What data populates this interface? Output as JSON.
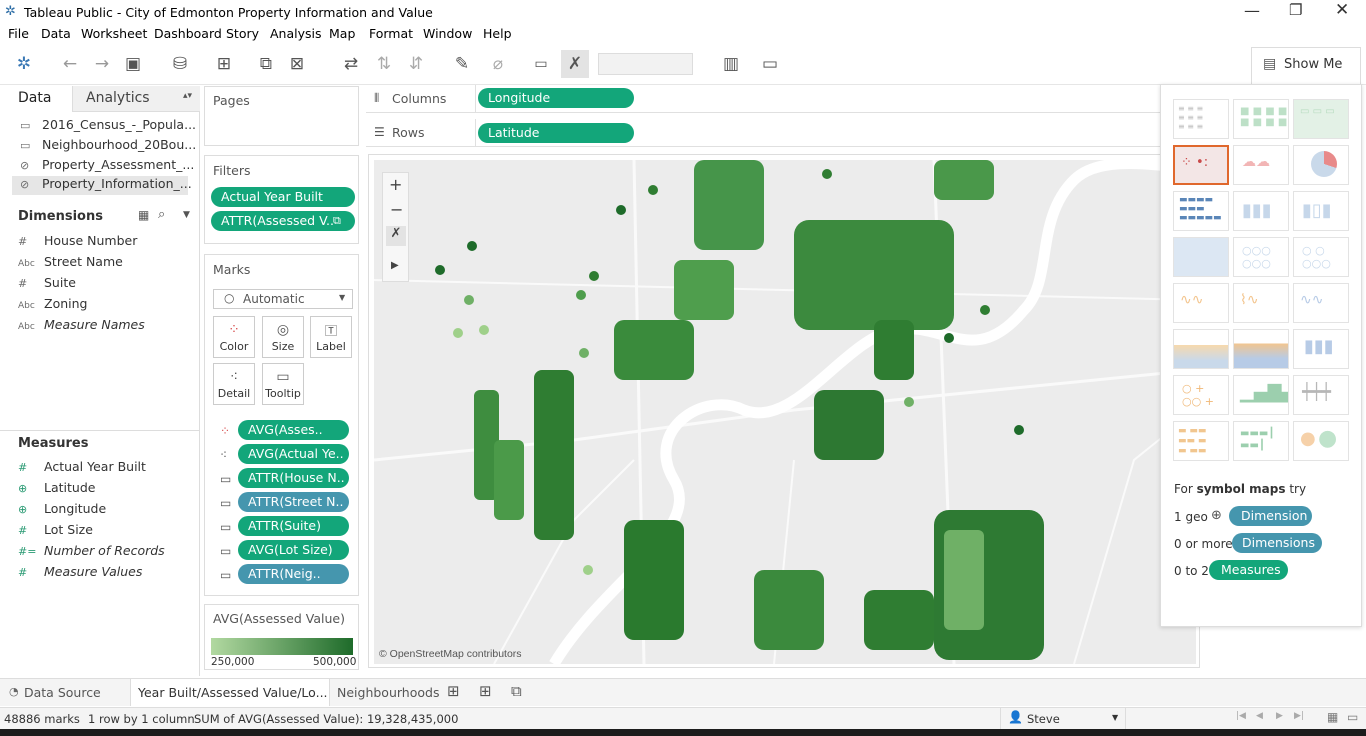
{
  "window": {
    "title": "Tableau Public - City of Edmonton Property Information and Value",
    "controls": [
      "minimize",
      "restore",
      "close"
    ]
  },
  "menu": [
    "File",
    "Data",
    "Worksheet",
    "Dashboard",
    "Story",
    "Analysis",
    "Map",
    "Format",
    "Window",
    "Help"
  ],
  "toolbar": {
    "show_me": "Show Me"
  },
  "sidebar": {
    "tabs": {
      "data": "Data",
      "analytics": "Analytics"
    },
    "sources": [
      "2016_Census_-_Popula...",
      "Neighbourhood_20Bou...",
      "Property_Assessment_...",
      "Property_Information_..."
    ],
    "dimensions_header": "Dimensions",
    "dimensions": [
      {
        "type": "#",
        "name": "House Number"
      },
      {
        "type": "Abc",
        "name": "Street Name"
      },
      {
        "type": "#",
        "name": "Suite"
      },
      {
        "type": "Abc",
        "name": "Zoning"
      },
      {
        "type": "Abc",
        "name": "Measure Names"
      }
    ],
    "measures_header": "Measures",
    "measures": [
      {
        "type": "#",
        "name": "Actual Year Built"
      },
      {
        "type": "geo",
        "name": "Latitude"
      },
      {
        "type": "geo",
        "name": "Longitude"
      },
      {
        "type": "#",
        "name": "Lot Size"
      },
      {
        "type": "#=",
        "name": "Number of Records"
      },
      {
        "type": "#",
        "name": "Measure Values"
      }
    ]
  },
  "pages": {
    "title": "Pages"
  },
  "filters": {
    "title": "Filters",
    "items": [
      "Actual Year Built",
      "ATTR(Assessed V.."
    ]
  },
  "marks": {
    "title": "Marks",
    "type": "Automatic",
    "buttons": {
      "color": "Color",
      "size": "Size",
      "label": "Label",
      "detail": "Detail",
      "tooltip": "Tooltip"
    },
    "pills": [
      "AVG(Asses..",
      "AVG(Actual Ye..",
      "ATTR(House N..",
      "ATTR(Street N..",
      "ATTR(Suite)",
      "AVG(Lot Size)",
      "ATTR(Neig.."
    ]
  },
  "legend": {
    "title": "AVG(Assessed Value)",
    "min": "250,000",
    "max": "500,000"
  },
  "shelves": {
    "columns_label": "Columns",
    "rows_label": "Rows",
    "columns": "Longitude",
    "rows": "Latitude"
  },
  "map": {
    "attribution": "© OpenStreetMap contributors",
    "zoom_in": "+",
    "zoom_out": "−"
  },
  "showme": {
    "hint_prefix": "For",
    "hint_type": "symbol maps",
    "hint_suffix": "try",
    "req1_label": "1 geo",
    "req1_pill": "Dimension",
    "req2_label": "0 or more",
    "req2_pill": "Dimensions",
    "req3_label": "0 to 2",
    "req3_pill": "Measures"
  },
  "sheet_tabs": {
    "data_source": "Data Source",
    "active": "Year Built/Assessed Value/Lo...",
    "other": "Neighbourhoods"
  },
  "status": {
    "marks": "48886 marks",
    "grid": "1 row by 1 column",
    "sum": "SUM of AVG(Assessed Value): 19,328,435,000",
    "user": "Steve"
  },
  "colors": {
    "accent_green": "#13a67a",
    "accent_blue": "#4596ae",
    "map_light": "#9fd08a",
    "map_dark": "#1e6b2a"
  }
}
